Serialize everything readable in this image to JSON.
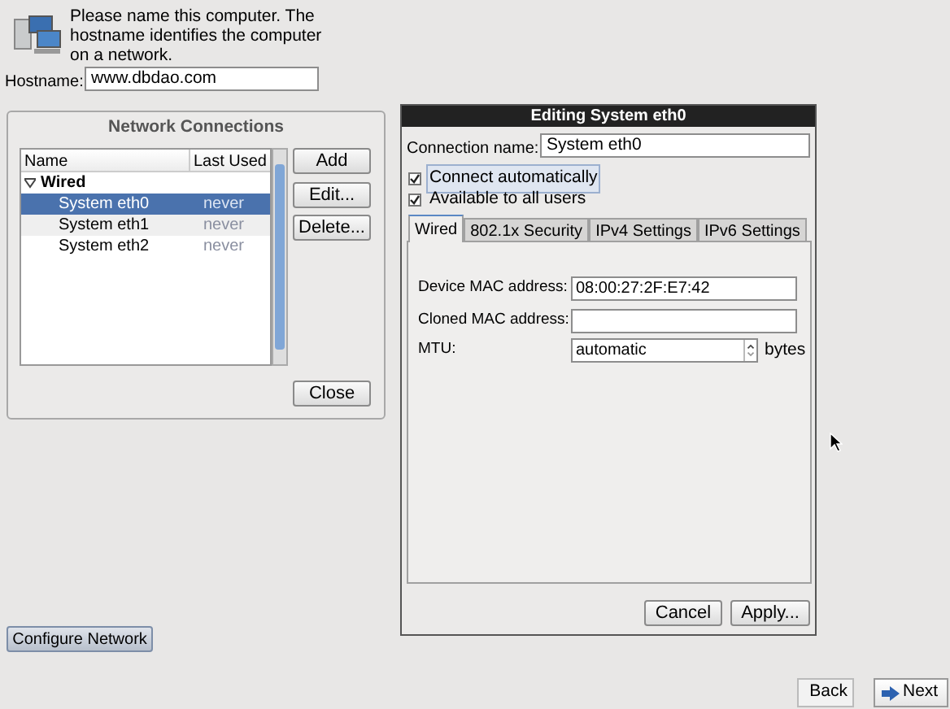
{
  "intro": {
    "text": "Please name this computer.  The hostname identifies the computer on a network."
  },
  "hostname": {
    "label": "Hostname:",
    "value": "www.dbdao.com"
  },
  "connections_window": {
    "title": "Network Connections",
    "columns": [
      "Name",
      "Last Used"
    ],
    "groups": [
      {
        "label": "Wired",
        "expanded": true,
        "children": [
          {
            "name": "System eth0",
            "last_used": "never",
            "selected": true
          },
          {
            "name": "System eth1",
            "last_used": "never",
            "selected": false
          },
          {
            "name": "System eth2",
            "last_used": "never",
            "selected": false
          }
        ]
      }
    ],
    "buttons": [
      "Add",
      "Edit...",
      "Delete..."
    ],
    "close": "Close"
  },
  "edit_window": {
    "title": "Editing System eth0",
    "connection_name": {
      "label": "Connection name:",
      "value": "System eth0"
    },
    "checkboxes": [
      {
        "label": "Connect automatically",
        "checked": true,
        "focused": true
      },
      {
        "label": "Available to all users",
        "checked": true,
        "focused": false
      }
    ],
    "tabs": [
      {
        "label": "Wired",
        "selected": true
      },
      {
        "label": "802.1x Security",
        "selected": false
      },
      {
        "label": "IPv4 Settings",
        "selected": false
      },
      {
        "label": "IPv6 Settings",
        "selected": false
      }
    ],
    "fields": [
      {
        "kind": "text",
        "label": "Device MAC address:",
        "value": "08:00:27:2F:E7:42"
      },
      {
        "kind": "text",
        "label": "Cloned MAC address:"
      },
      {
        "kind": "spin",
        "label": "MTU:",
        "value": "automatic",
        "unit": "bytes"
      }
    ],
    "buttons": [
      "Cancel",
      "Apply..."
    ]
  },
  "configure_button": "Configure Network",
  "nav": {
    "back": "Back",
    "next": "Next"
  }
}
